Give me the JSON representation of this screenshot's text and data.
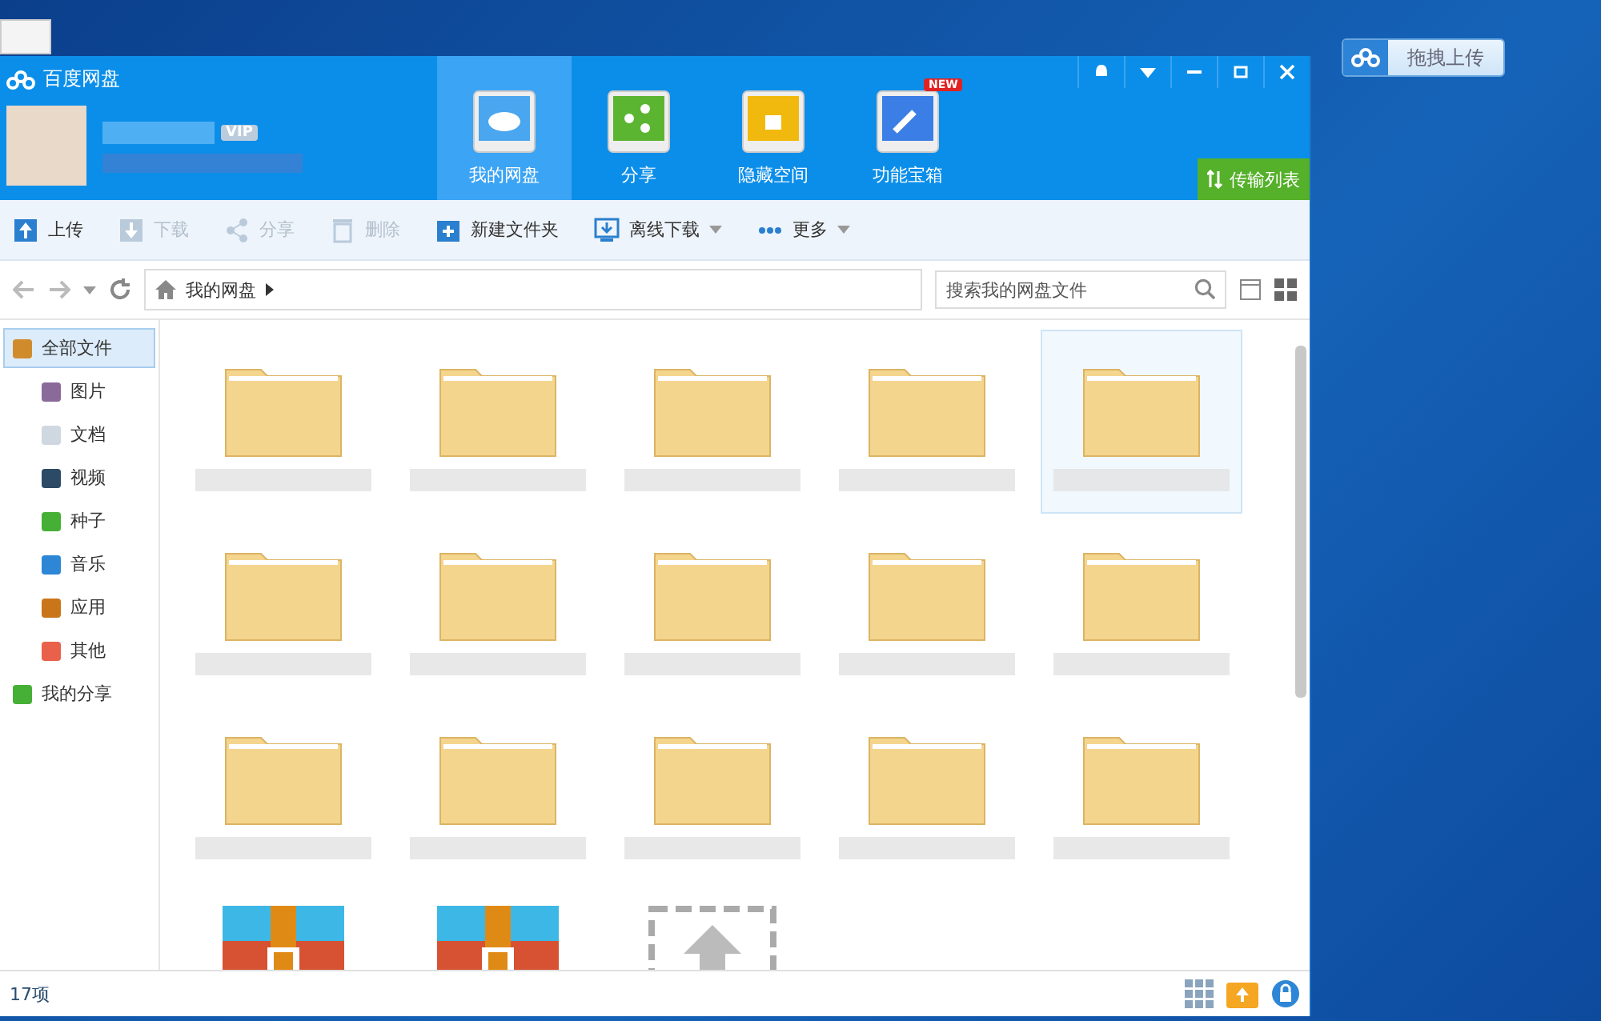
{
  "desktop_widget": {
    "label": "拖拽上传"
  },
  "window": {
    "title": "百度网盘"
  },
  "account": {
    "badge": "VIP"
  },
  "nav_tabs": [
    {
      "label": "我的网盘",
      "kind": "cloud",
      "selected": true
    },
    {
      "label": "分享",
      "kind": "share",
      "selected": false
    },
    {
      "label": "隐藏空间",
      "kind": "lock",
      "selected": false
    },
    {
      "label": "功能宝箱",
      "kind": "tool",
      "selected": false,
      "badge": "NEW"
    }
  ],
  "transfer_button": {
    "label": "传输列表"
  },
  "toolbar": [
    {
      "label": "上传",
      "kind": "upload",
      "disabled": false,
      "dropdown": false
    },
    {
      "label": "下载",
      "kind": "download",
      "disabled": true,
      "dropdown": false
    },
    {
      "label": "分享",
      "kind": "share",
      "disabled": true,
      "dropdown": false
    },
    {
      "label": "删除",
      "kind": "delete",
      "disabled": true,
      "dropdown": false
    },
    {
      "label": "新建文件夹",
      "kind": "folder",
      "disabled": false,
      "dropdown": false
    },
    {
      "label": "离线下载",
      "kind": "offline",
      "disabled": false,
      "dropdown": true
    },
    {
      "label": "更多",
      "kind": "more",
      "disabled": false,
      "dropdown": true
    }
  ],
  "breadcrumb": {
    "path": "我的网盘"
  },
  "search": {
    "placeholder": "搜索我的网盘文件"
  },
  "sidebar": [
    {
      "label": "全部文件",
      "kind": "all",
      "selected": true,
      "children": [
        {
          "label": "图片",
          "kind": "image",
          "selected": false
        },
        {
          "label": "文档",
          "kind": "doc",
          "selected": false
        },
        {
          "label": "视频",
          "kind": "video",
          "selected": false
        },
        {
          "label": "种子",
          "kind": "bt",
          "selected": false
        },
        {
          "label": "音乐",
          "kind": "music",
          "selected": false
        },
        {
          "label": "应用",
          "kind": "app",
          "selected": false
        },
        {
          "label": "其他",
          "kind": "other",
          "selected": false
        }
      ]
    },
    {
      "label": "我的分享",
      "kind": "share",
      "selected": false
    }
  ],
  "files": [
    {
      "kind": "folder",
      "selected": false
    },
    {
      "kind": "folder",
      "selected": false
    },
    {
      "kind": "folder",
      "selected": false
    },
    {
      "kind": "folder",
      "selected": false
    },
    {
      "kind": "folder",
      "selected": true
    },
    {
      "kind": "folder",
      "selected": false
    },
    {
      "kind": "folder",
      "selected": false
    },
    {
      "kind": "folder",
      "selected": false
    },
    {
      "kind": "folder",
      "selected": false
    },
    {
      "kind": "folder",
      "selected": false
    },
    {
      "kind": "folder",
      "selected": false
    },
    {
      "kind": "folder",
      "selected": false
    },
    {
      "kind": "folder",
      "selected": false
    },
    {
      "kind": "folder",
      "selected": false
    },
    {
      "kind": "folder",
      "selected": false
    },
    {
      "kind": "archive",
      "selected": false
    },
    {
      "kind": "archive",
      "selected": false
    },
    {
      "kind": "upload",
      "selected": false
    }
  ],
  "status_bar": {
    "count": "17项"
  }
}
